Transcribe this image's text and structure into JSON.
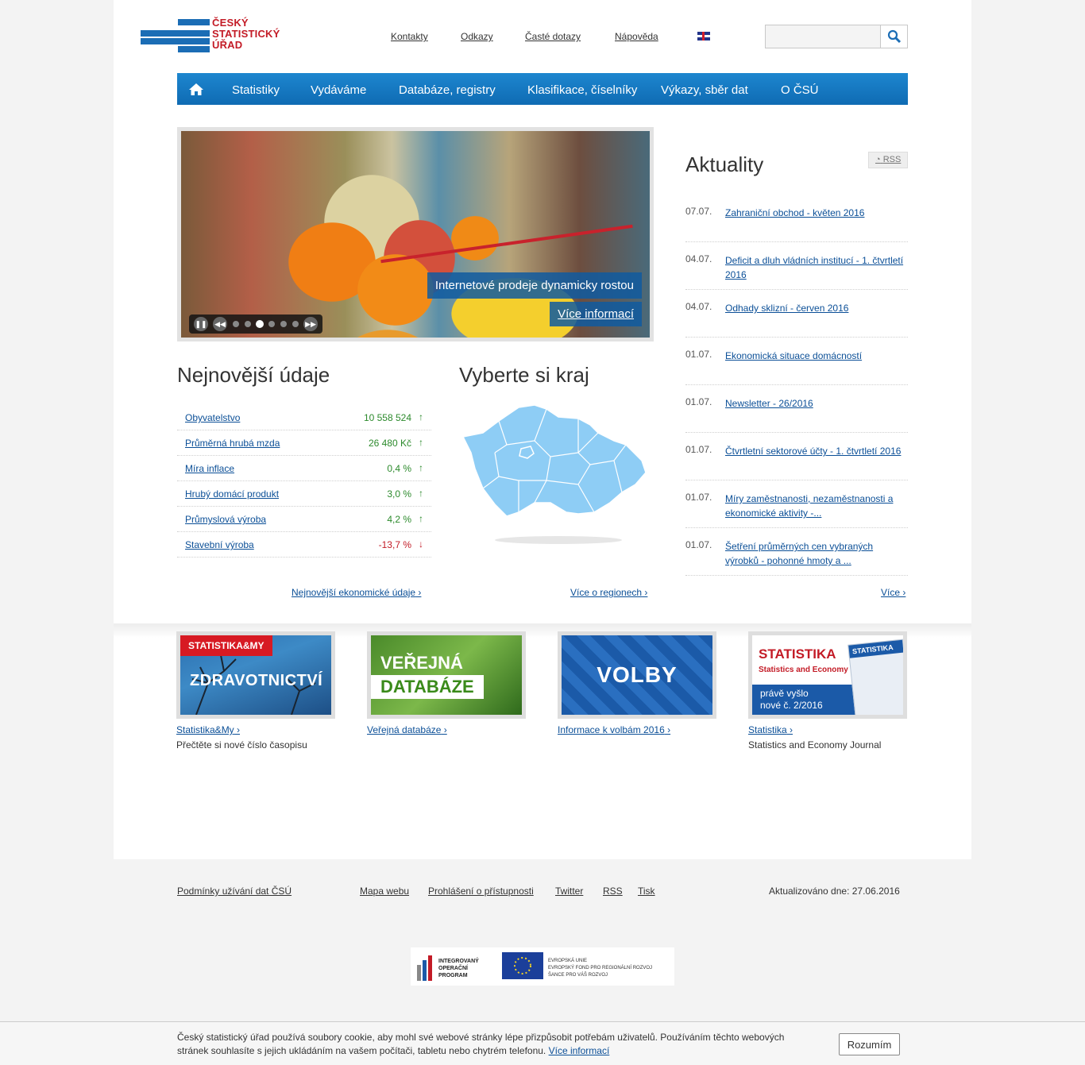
{
  "header": {
    "logo_lines": [
      "ČESKÝ",
      "STATISTICKÝ",
      "ÚŘAD"
    ],
    "links": [
      "Kontakty",
      "Odkazy",
      "Časté dotazy",
      "Nápověda"
    ],
    "search_value": ""
  },
  "nav": {
    "items": [
      "Statistiky",
      "Vydáváme",
      "Databáze, registry",
      "Klasifikace, číselníky",
      "Výkazy, sběr dat",
      "O ČSÚ"
    ]
  },
  "slider": {
    "caption": "Internetové prodeje dynamicky rostou",
    "more_label": "Více informací",
    "dots": 6,
    "active_dot": 3
  },
  "latest": {
    "title": "Nejnovější údaje",
    "rows": [
      {
        "label": "Obyvatelstvo",
        "value": "10 558 524",
        "trend": "up"
      },
      {
        "label": "Průměrná hrubá mzda",
        "value": "26 480 Kč",
        "trend": "up"
      },
      {
        "label": "Míra inflace",
        "value": "0,4 %",
        "trend": "up"
      },
      {
        "label": "Hrubý domácí produkt",
        "value": "3,0 %",
        "trend": "up"
      },
      {
        "label": "Průmyslová výroba",
        "value": "4,2 %",
        "trend": "up"
      },
      {
        "label": "Stavební výroba",
        "value": "-13,7 %",
        "trend": "down"
      }
    ],
    "more_label": "Nejnovější ekonomické údaje"
  },
  "region": {
    "title": "Vyberte si kraj",
    "more_label": "Více o regionech"
  },
  "news": {
    "title": "Aktuality",
    "rss_label": "RSS",
    "items": [
      {
        "date": "07.07.",
        "title": "Zahraniční obchod - květen 2016"
      },
      {
        "date": "04.07.",
        "title": "Deficit a dluh vládních institucí - 1. čtvrtletí 2016"
      },
      {
        "date": "04.07.",
        "title": "Odhady sklizní - červen 2016"
      },
      {
        "date": "01.07.",
        "title": "Ekonomická situace domácností"
      },
      {
        "date": "01.07.",
        "title": "Newsletter - 26/2016"
      },
      {
        "date": "01.07.",
        "title": "Čtvrtletní sektorové účty - 1. čtvrtletí 2016"
      },
      {
        "date": "01.07.",
        "title": "Míry zaměstnanosti, nezaměstnanosti a ekonomické aktivity -..."
      },
      {
        "date": "01.07.",
        "title": "Šetření průměrných cen vybraných výrobků - pohonné hmoty a ..."
      }
    ],
    "more_label": "Více"
  },
  "tiles": [
    {
      "img_tag": "STATISTIKA&MY",
      "img_title": "ZDRAVOTNICTVÍ",
      "link": "Statistika&My",
      "desc": "Přečtěte si nové číslo časopisu"
    },
    {
      "img_line1": "VEŘEJNÁ",
      "img_line2": "DATABÁZE",
      "link": "Veřejná databáze",
      "desc": ""
    },
    {
      "img_title": "VOLBY",
      "link": "Informace k volbám 2016",
      "desc": ""
    },
    {
      "img_title": "STATISTIKA",
      "img_sub": "Statistics and Economy Journal",
      "img_note1": "právě vyšlo",
      "img_note2": "nové č. 2/2016",
      "img_cover": "STATISTIKA",
      "link": "Statistika",
      "desc": "Statistics and Economy Journal"
    }
  ],
  "footer": {
    "links": [
      "Podmínky užívání dat ČSÚ",
      "Mapa webu",
      "Prohlášení o přístupnosti",
      "Twitter",
      "RSS",
      "Tisk"
    ],
    "updated": "Aktualizováno dne: 27.06.2016",
    "eu_left": [
      "INTEGROVANÝ",
      "OPERAČNÍ",
      "PROGRAM"
    ],
    "eu_right": [
      "EVROPSKÁ UNIE",
      "EVROPSKÝ FOND PRO REGIONÁLNÍ ROZVOJ",
      "ŠANCE PRO VÁŠ ROZVOJ"
    ]
  },
  "cookie": {
    "message": "Český statistický úřad používá soubory cookie, aby mohl své webové stránky lépe přizpůsobit potřebám uživatelů. Používáním těchto webových stránek souhlasíte s jejich ukládáním na vašem počítači, tabletu nebo chytrém telefonu.",
    "link_label": "Více informací",
    "button_label": "Rozumím"
  },
  "colors": {
    "brand_blue": "#1b6db5",
    "brand_red": "#c31b26",
    "nav_blue": "#1478c3",
    "positive": "#2c8a2c",
    "negative": "#c31b26"
  }
}
